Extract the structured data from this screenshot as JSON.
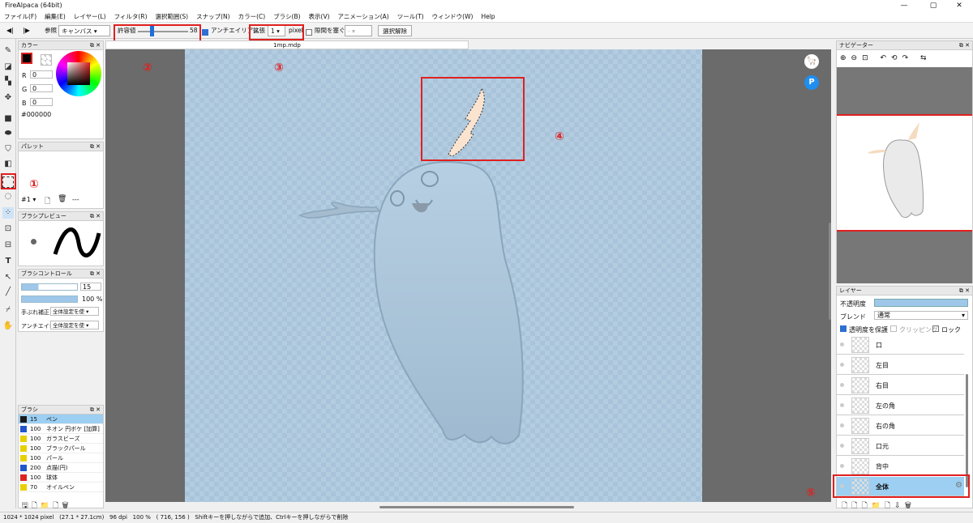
{
  "app": {
    "title": "FireAlpaca (64bit)",
    "minimize": "—",
    "maximize": "▢",
    "close": "✕"
  },
  "menu": [
    "ファイル(F)",
    "編集(E)",
    "レイヤー(L)",
    "フィルタ(R)",
    "選択範囲(S)",
    "スナップ(N)",
    "カラー(C)",
    "ブラシ(B)",
    "表示(V)",
    "アニメーション(A)",
    "ツール(T)",
    "ウィンドウ(W)",
    "Help"
  ],
  "toolbar": {
    "ref_label": "参照",
    "ref_value": "キャンバス",
    "tolerance_label": "許容値",
    "tolerance_value": "58",
    "tolerance_fraction": 0.58,
    "antialias_label": "アンチエイリアス",
    "expand_label": "拡張",
    "expand_value": "1",
    "expand_unit": "pixel",
    "gap_label": "隙間を塞ぐ",
    "deselect_label": "選択解除",
    "prev_icon": "◀|",
    "next_icon": "|▶"
  },
  "doc": {
    "tab": "1mp.mdp"
  },
  "annotations": [
    "①",
    "②",
    "③",
    "④",
    "⑤"
  ],
  "color_panel": {
    "title": "カラー",
    "r_label": "R",
    "r": "0",
    "g_label": "G",
    "g": "0",
    "b_label": "B",
    "b": "0",
    "hex": "#000000",
    "primary": "#000000"
  },
  "palette_panel": {
    "title": "パレット",
    "index": "#1 ▾",
    "dash": "---"
  },
  "brush_preview": {
    "title": "ブラシプレビュー"
  },
  "brush_control": {
    "title": "ブラシコントロール",
    "size": "15",
    "opacity": "100 %",
    "stabilizer_label": "手ぶれ補正",
    "stabilizer_value": "全体設定を使 ▾",
    "antialias_label": "アンチエイ!",
    "antialias_value": "全体設定を使 ▾"
  },
  "brush_panel": {
    "title": "ブラシ",
    "items": [
      {
        "size": "15",
        "name": "ペン",
        "color": "#1a1a1a",
        "selected": true
      },
      {
        "size": "100",
        "name": "ネオン 円ボケ [加算]",
        "color": "#2255cc",
        "selected": false
      },
      {
        "size": "100",
        "name": "ガラスビーズ",
        "color": "#e8d000",
        "selected": false
      },
      {
        "size": "100",
        "name": "ブラックパール",
        "color": "#e8d000",
        "selected": false
      },
      {
        "size": "100",
        "name": "パール",
        "color": "#e8d000",
        "selected": false
      },
      {
        "size": "200",
        "name": "点描(円)",
        "color": "#2255cc",
        "selected": false
      },
      {
        "size": "100",
        "name": "球体",
        "color": "#dd2222",
        "selected": false
      },
      {
        "size": "70",
        "name": "オイルペン",
        "color": "#e8d000",
        "selected": false
      }
    ]
  },
  "navigator": {
    "title": "ナビゲーター"
  },
  "layers": {
    "title": "レイヤー",
    "opacity_label": "不透明度",
    "blend_label": "ブレンド",
    "blend_value": "通常",
    "protect_label": "透明度を保護",
    "clipping_label": "クリッピング",
    "lock_label": "ロック",
    "items": [
      {
        "name": "口",
        "selected": false
      },
      {
        "name": "左目",
        "selected": false
      },
      {
        "name": "右目",
        "selected": false
      },
      {
        "name": "左の角",
        "selected": false
      },
      {
        "name": "右の角",
        "selected": false
      },
      {
        "name": "口元",
        "selected": false
      },
      {
        "name": "背中",
        "selected": false
      },
      {
        "name": "全体",
        "selected": true
      }
    ]
  },
  "status": {
    "dims": "1024 * 1024 pixel",
    "size_cm": "(27.1 * 27.1cm)",
    "dpi": "96 dpi",
    "zoom": "100 %",
    "coords": "( 716, 156 )",
    "hint": "Shiftキーを押しながらで追加、Ctrlキーを押しながらで削除"
  },
  "colors": {
    "accent": "#e02020",
    "canvas_bg": "#b3cce0",
    "selection": "#fbe4cf",
    "layer_selected": "#9ccff2"
  }
}
